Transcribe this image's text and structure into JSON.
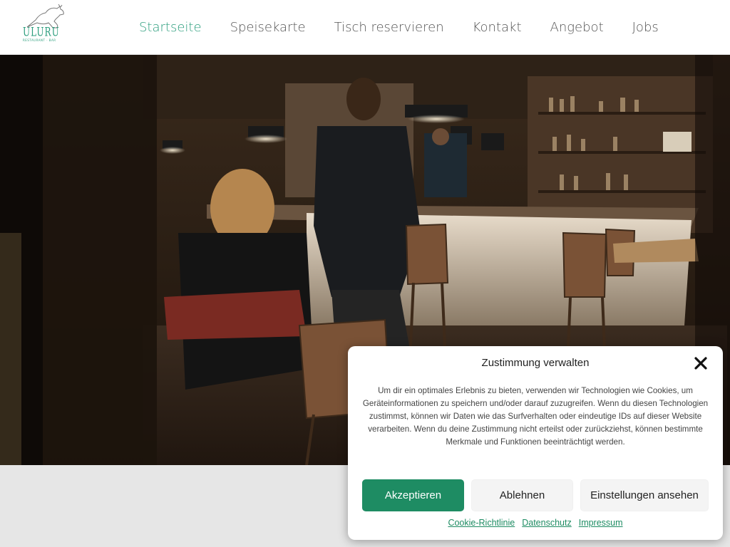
{
  "header": {
    "logo_text": "ULURU",
    "logo_subtext": "RESTAURANT · BAR",
    "nav": [
      {
        "label": "Startseite",
        "active": true
      },
      {
        "label": "Speisekarte",
        "active": false
      },
      {
        "label": "Tisch reservieren",
        "active": false
      },
      {
        "label": "Kontakt",
        "active": false
      },
      {
        "label": "Angebot",
        "active": false
      },
      {
        "label": "Jobs",
        "active": false
      }
    ]
  },
  "hero": {
    "image_icon": "restaurant-interior-photo"
  },
  "consent": {
    "title": "Zustimmung verwalten",
    "close_icon": "close-icon",
    "text": "Um dir ein optimales Erlebnis zu bieten, verwenden wir Technologien wie Cookies, um Geräteinformationen zu speichern und/oder darauf zuzugreifen. Wenn du diesen Technologien zustimmst, können wir Daten wie das Surfverhalten oder eindeutige IDs auf dieser Website verarbeiten. Wenn du deine Zustimmung nicht erteilst oder zurückziehst, können bestimmte Merkmale und Funktionen beeinträchtigt werden.",
    "accept_label": "Akzeptieren",
    "deny_label": "Ablehnen",
    "settings_label": "Einstellungen ansehen",
    "links": [
      "Cookie-Richtlinie",
      "Datenschutz",
      "Impressum"
    ]
  },
  "colors": {
    "accent": "#2a9d7c",
    "accept_button": "#1e8c63"
  }
}
